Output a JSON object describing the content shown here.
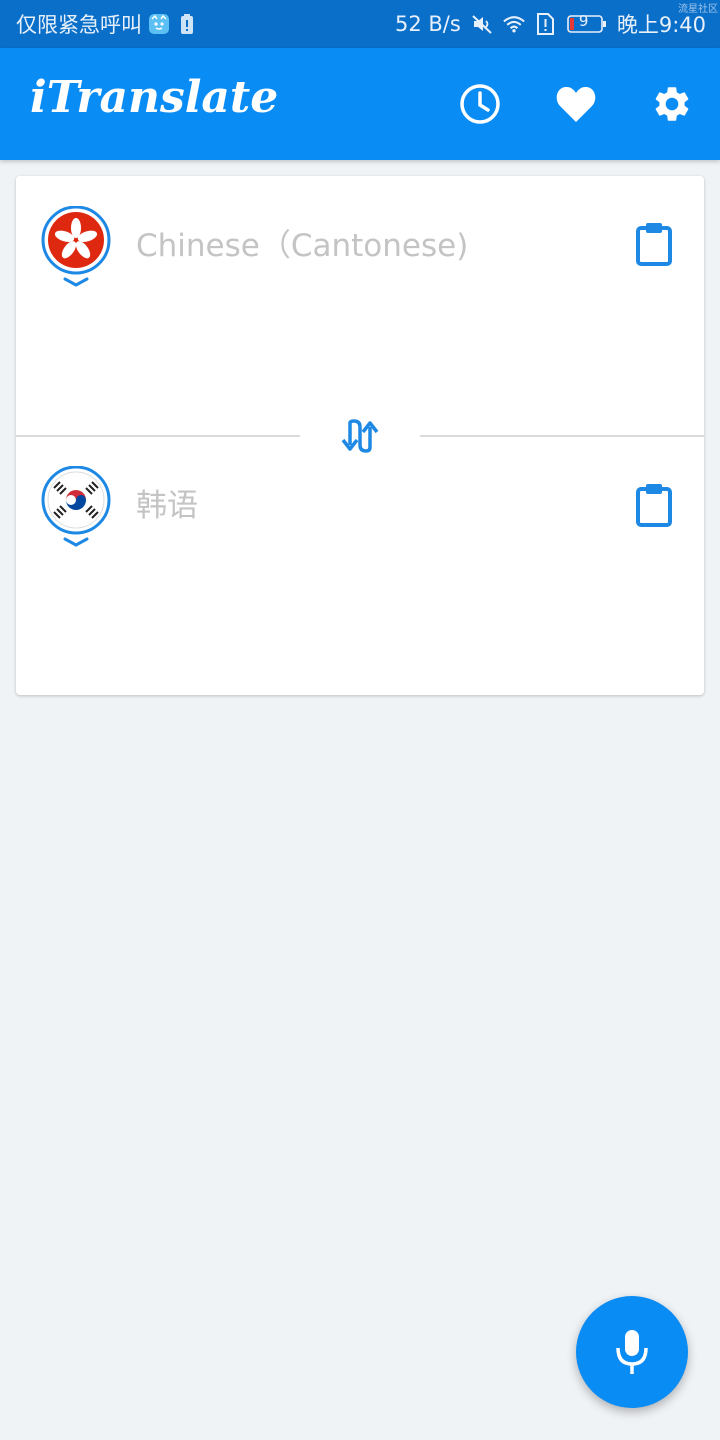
{
  "status_bar": {
    "carrier_text": "仅限紧急呼叫",
    "network_speed": "52 B/s",
    "battery_level": "9",
    "time": "晚上9:40",
    "watermark": "流星社区"
  },
  "app_bar": {
    "title": "iTranslate",
    "history_icon": "history-clock-icon",
    "favorites_icon": "heart-icon",
    "settings_icon": "gear-icon"
  },
  "source": {
    "language_placeholder": "Chinese（Cantonese)",
    "flag": "hong-kong-flag",
    "paste_icon": "clipboard-icon"
  },
  "target": {
    "language_placeholder": "韩语",
    "flag": "south-korea-flag",
    "paste_icon": "clipboard-icon"
  },
  "swap_icon": "swap-arrows-icon",
  "mic_icon": "microphone-icon",
  "colors": {
    "status_bar": "#0a6fc9",
    "app_bar": "#0a8cf5",
    "accent": "#1e88e5",
    "background": "#f0f3f6",
    "placeholder": "#c4c4c4",
    "hk_red": "#de2910",
    "kr_red": "#cd2e3a",
    "kr_blue": "#0047a0"
  }
}
